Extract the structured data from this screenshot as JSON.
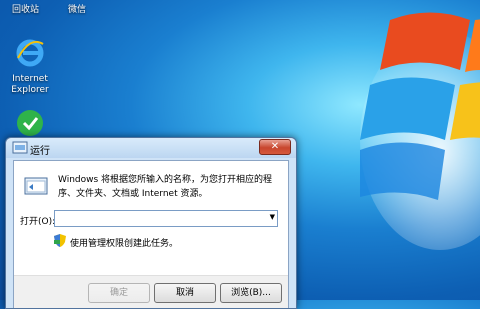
{
  "desktop": {
    "top_labels": [
      "回收站",
      "微信"
    ],
    "icons": [
      {
        "label_line1": "Internet",
        "label_line2": "Explorer",
        "icon": "internet-explorer-icon"
      },
      {
        "label_line1": "",
        "label_line2": "",
        "icon": "green-app-icon"
      }
    ]
  },
  "dialog": {
    "title": "运行",
    "close_label": "✕",
    "description": "Windows 将根据您所输入的名称，为您打开相应的程序、文件夹、文档或 Internet 资源。",
    "open_label": "打开(O):",
    "open_value": "",
    "admin_note": "使用管理权限创建此任务。",
    "buttons": {
      "ok": "确定",
      "cancel": "取消",
      "browse": "浏览(B)..."
    }
  }
}
